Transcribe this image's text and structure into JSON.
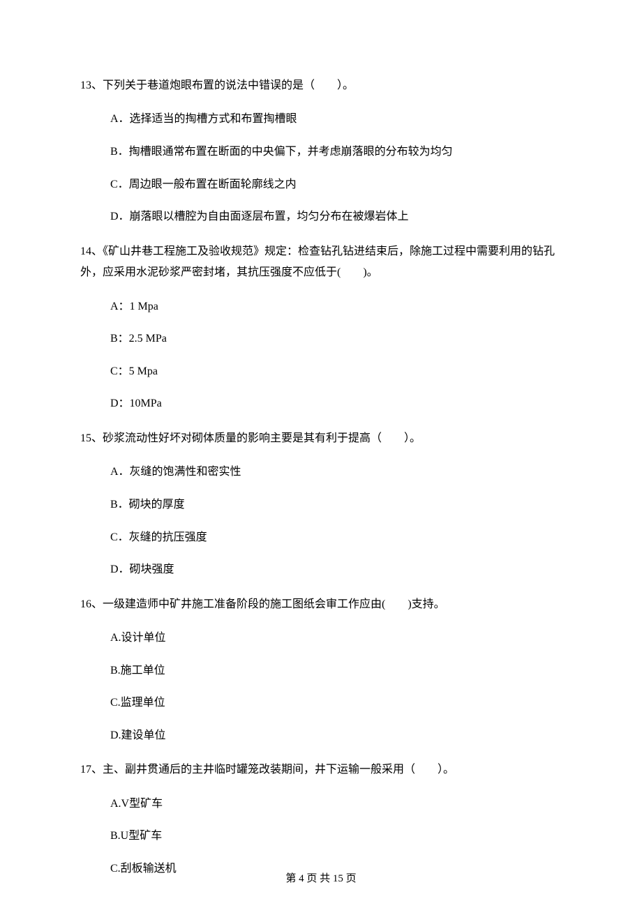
{
  "questions": [
    {
      "number": "13、",
      "text": "下列关于巷道炮眼布置的说法中错误的是（　　）。",
      "options": [
        "A．选择适当的掏槽方式和布置掏槽眼",
        "B．掏槽眼通常布置在断面的中央偏下，并考虑崩落眼的分布较为均匀",
        "C．周边眼一般布置在断面轮廓线之内",
        "D．崩落眼以槽腔为自由面逐层布置，均匀分布在被爆岩体上"
      ]
    },
    {
      "number": "14、",
      "text": "《矿山井巷工程施工及验收规范》规定：检查钻孔钻进结束后，除施工过程中需要利用的钻孔外，应采用水泥砂浆严密封堵，其抗压强度不应低于(　　)。",
      "options": [
        "A：1 Mpa",
        "B：2.5 MPa",
        "C：5 Mpa",
        "D：10MPa"
      ]
    },
    {
      "number": "15、",
      "text": "砂浆流动性好坏对砌体质量的影响主要是其有利于提高（　　）。",
      "options": [
        "A．灰缝的饱满性和密实性",
        "B．砌块的厚度",
        "C．灰缝的抗压强度",
        "D．砌块强度"
      ]
    },
    {
      "number": "16、",
      "text": "一级建造师中矿井施工准备阶段的施工图纸会审工作应由(　　)支持。",
      "options": [
        "A.设计单位",
        "B.施工单位",
        "C.监理单位",
        "D.建设单位"
      ]
    },
    {
      "number": "17、",
      "text": "主、副井贯通后的主井临时罐笼改装期间，井下运输一般采用（　　）。",
      "options": [
        "A.V型矿车",
        "B.U型矿车",
        "C.刮板输送机"
      ]
    }
  ],
  "footer": "第 4 页 共 15 页"
}
